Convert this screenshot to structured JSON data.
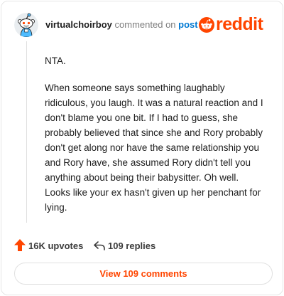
{
  "header": {
    "username": "virtualchoirboy",
    "action_text": "commented on",
    "post_link": "post",
    "brand": "reddit"
  },
  "comment": {
    "paragraphs": [
      "NTA.",
      "When someone says something laughably ridiculous, you laugh. It was a natural reaction and I don't blame you one bit. If I had to guess, she probably believed that since she and Rory probably don't get along nor have the same relationship you and Rory have, she assumed Rory didn't tell you anything about being their babysitter. Oh well. Looks like your ex hasn't given up her penchant for lying."
    ]
  },
  "actions": {
    "upvotes": "16K upvotes",
    "replies": "109 replies"
  },
  "footer": {
    "view_comments": "View 109 comments"
  },
  "colors": {
    "brand": "#ff4500",
    "link": "#0079d3",
    "muted": "#7c7c7c"
  },
  "icons": [
    "snoo-avatar-icon",
    "reddit-logo-icon",
    "upvote-arrow-icon",
    "reply-arrow-icon"
  ]
}
